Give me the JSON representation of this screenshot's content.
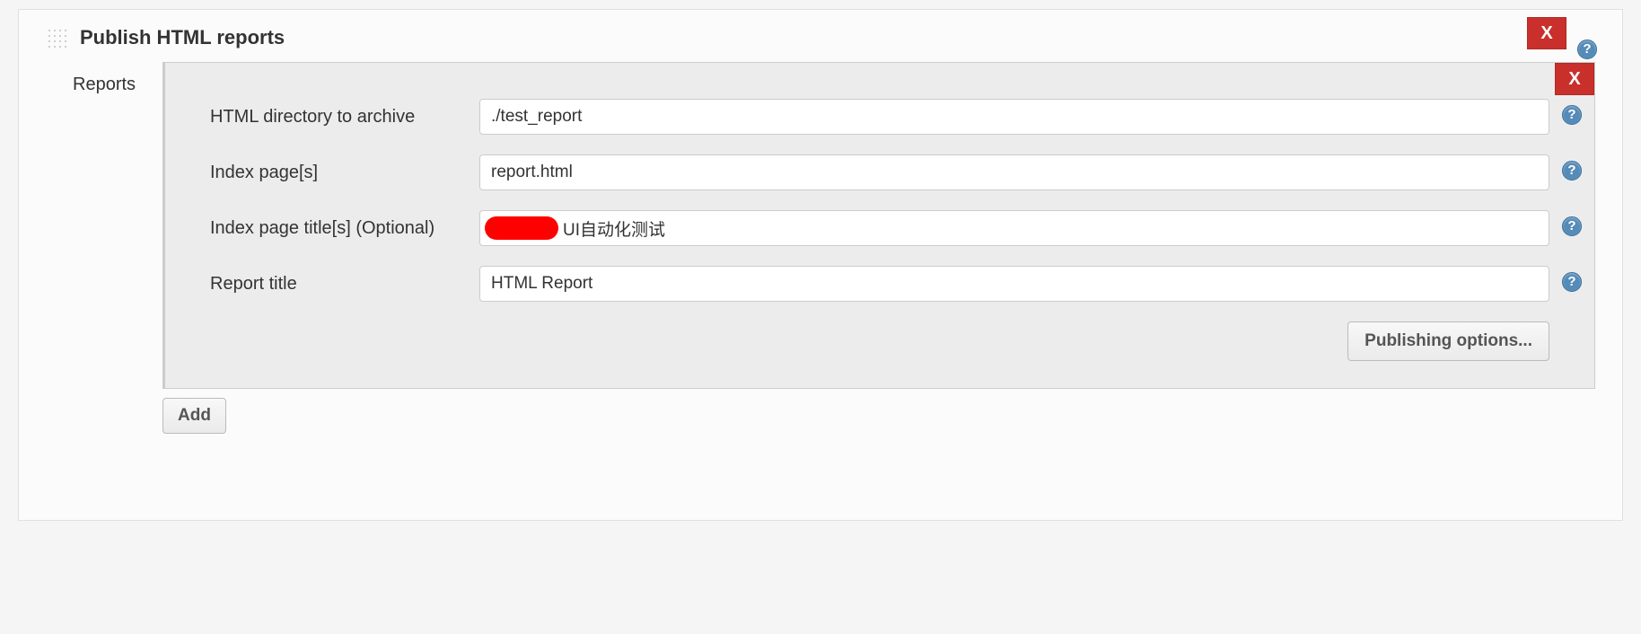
{
  "section": {
    "title": "Publish HTML reports",
    "reports_label": "Reports",
    "add_button": "Add",
    "publishing_options": "Publishing options...",
    "close_label": "X"
  },
  "report": {
    "fields": {
      "html_dir": {
        "label": "HTML directory to archive",
        "value": "./test_report"
      },
      "index_pages": {
        "label": "Index page[s]",
        "value": "report.html"
      },
      "index_titles": {
        "label": "Index page title[s] (Optional)",
        "value": "UI自动化测试"
      },
      "report_title": {
        "label": "Report title",
        "value": "HTML Report"
      }
    }
  }
}
